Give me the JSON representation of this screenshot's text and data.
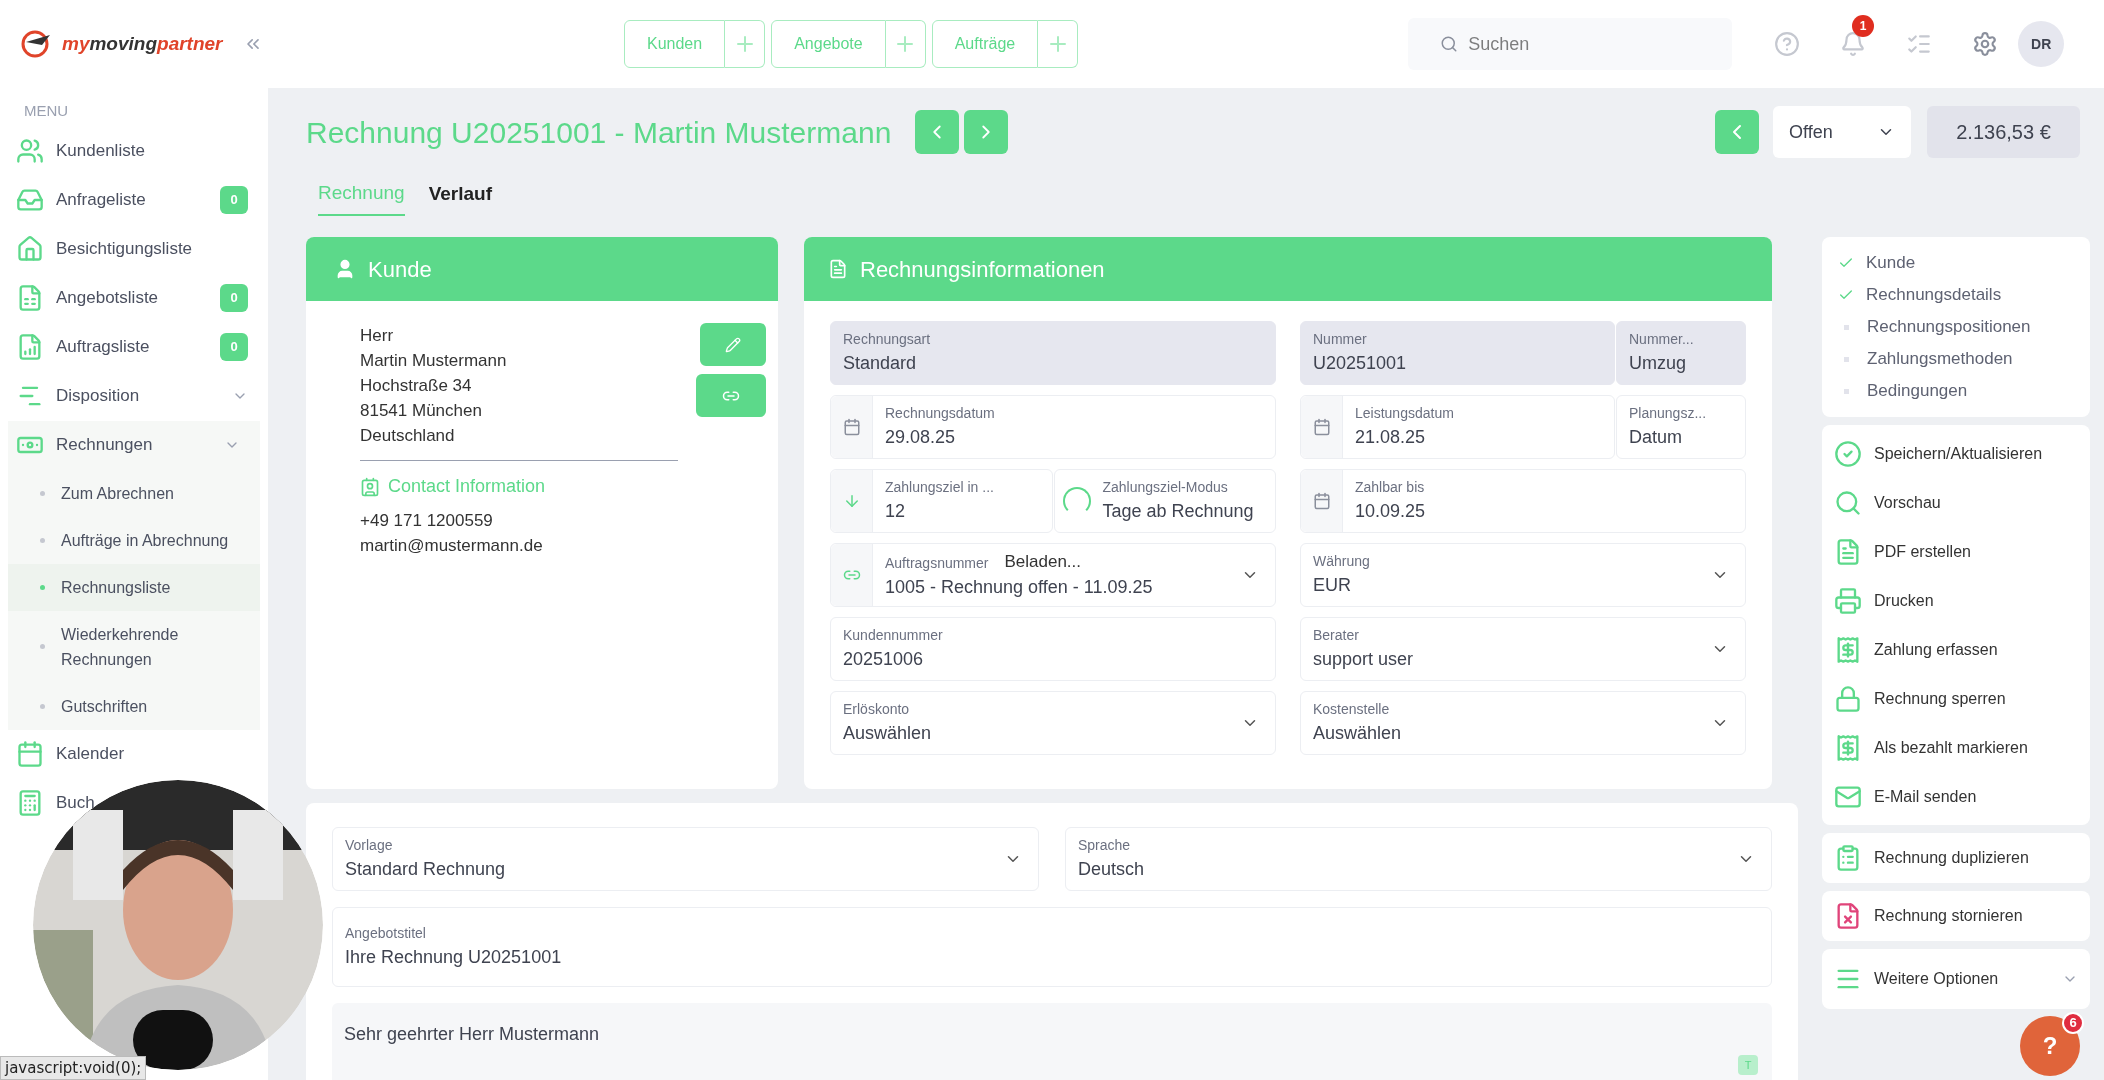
{
  "header": {
    "logo_parts": [
      {
        "text": "my",
        "kind": "accent"
      },
      {
        "text": "moving",
        "kind": "plain"
      },
      {
        "text": "partner",
        "kind": "accent"
      }
    ],
    "quick_create": [
      {
        "label": "Kunden"
      },
      {
        "label": "Angebote"
      },
      {
        "label": "Aufträge"
      }
    ],
    "search": {
      "placeholder": "Suchen"
    },
    "notification_count": "1",
    "avatar": "DR"
  },
  "sidebar": {
    "menu_label": "MENU",
    "items": [
      {
        "label": "Kundenliste",
        "kind": "link"
      },
      {
        "label": "Anfrageliste",
        "kind": "link",
        "badge": "0"
      },
      {
        "label": "Besichtigungsliste",
        "kind": "link"
      },
      {
        "label": "Angebotsliste",
        "kind": "link",
        "badge": "0"
      },
      {
        "label": "Auftragsliste",
        "kind": "link",
        "badge": "0"
      },
      {
        "label": "Disposition",
        "kind": "group"
      },
      {
        "label": "Rechnungen",
        "kind": "group",
        "expanded": true,
        "children": [
          {
            "label": "Zum Abrechnen",
            "selected": false
          },
          {
            "label": "Aufträge in Abrechnung",
            "selected": false
          },
          {
            "label": "Rechnungsliste",
            "selected": true
          },
          {
            "label": "Wiederkehrende Rechnungen",
            "selected": false
          },
          {
            "label": "Gutschriften",
            "selected": false
          }
        ]
      },
      {
        "label": "Kalender",
        "kind": "link"
      },
      {
        "label": "Buch",
        "kind": "link"
      }
    ]
  },
  "page": {
    "title": "Rechnung U20251001 - Martin Mustermann",
    "status": "Offen",
    "amount": "2.136,53 €",
    "tabs": [
      {
        "label": "Rechnung",
        "selected": true
      },
      {
        "label": "Verlauf",
        "selected": false
      }
    ]
  },
  "customer_card": {
    "title": "Kunde",
    "address": [
      "Herr",
      "Martin Mustermann",
      "Hochstraße 34",
      "81541 München",
      "Deutschland"
    ],
    "contact_title": "Contact Information",
    "phone": "+49 171 1200559",
    "email": "martin@mustermann.de"
  },
  "info_card": {
    "title": "Rechnungsinformationen",
    "left": [
      [
        {
          "label": "Rechnungsart",
          "value": "Standard",
          "kind": "readonly"
        }
      ],
      [
        {
          "label": "Rechnungsdatum",
          "value": "29.08.25",
          "kind": "date"
        }
      ],
      [
        {
          "label": "Zahlungsziel in ...",
          "value": "12",
          "kind": "term"
        },
        {
          "label": "Zahlungsziel-Modus",
          "value": "Tage ab Rechnung",
          "kind": "plain",
          "loading": true
        }
      ],
      [
        {
          "label": "Auftragsnummer",
          "value": "1005 - Rechnung offen - 11.09.25",
          "kind": "order",
          "loading_text": "Beladen..."
        }
      ],
      [
        {
          "label": "Kundennummer",
          "value": "20251006",
          "kind": "plain"
        }
      ],
      [
        {
          "label": "Erlöskonto",
          "value": "Auswählen",
          "kind": "select"
        }
      ]
    ],
    "right": [
      [
        {
          "label": "Nummer",
          "value": "U20251001",
          "kind": "readonly"
        },
        {
          "label": "Nummer...",
          "value": "Umzug",
          "kind": "readonly"
        }
      ],
      [
        {
          "label": "Leistungsdatum",
          "value": "21.08.25",
          "kind": "date"
        },
        {
          "label": "Planungsz...",
          "value": "Datum",
          "kind": "plain"
        }
      ],
      [
        {
          "label": "Zahlbar bis",
          "value": "10.09.25",
          "kind": "date"
        }
      ],
      [
        {
          "label": "Währung",
          "value": "EUR",
          "kind": "select"
        }
      ],
      [
        {
          "label": "Berater",
          "value": "support user",
          "kind": "select"
        }
      ],
      [
        {
          "label": "Kostenstelle",
          "value": "Auswählen",
          "kind": "select"
        }
      ]
    ]
  },
  "text_card": {
    "template": {
      "label": "Vorlage",
      "value": "Standard Rechnung"
    },
    "language": {
      "label": "Sprache",
      "value": "Deutsch"
    },
    "subject": {
      "label": "Angebotstitel",
      "value": "Ihre Rechnung U20251001"
    },
    "greeting": "Sehr geehrter Herr Mustermann",
    "editor_badge": "T"
  },
  "steps": [
    {
      "label": "Kunde",
      "done": true
    },
    {
      "label": "Rechnungsdetails",
      "done": true
    },
    {
      "label": "Rechnungspositionen",
      "done": false
    },
    {
      "label": "Zahlungsmethoden",
      "done": false
    },
    {
      "label": "Bedingungen",
      "done": false
    }
  ],
  "actions": [
    {
      "label": "Speichern/Aktualisieren"
    },
    {
      "label": "Vorschau"
    },
    {
      "label": "PDF erstellen"
    },
    {
      "label": "Drucken"
    },
    {
      "label": "Zahlung erfassen"
    },
    {
      "label": "Rechnung sperren"
    },
    {
      "label": "Als bezahlt markieren"
    },
    {
      "label": "E-Mail senden"
    }
  ],
  "extra_actions": [
    {
      "label": "Rechnung duplizieren",
      "kind": "plain"
    },
    {
      "label": "Rechnung stornieren",
      "kind": "danger"
    },
    {
      "label": "Weitere Optionen",
      "kind": "dropdown"
    }
  ],
  "status_bar": "javascript:void(0);",
  "help": {
    "label": "?",
    "badge": "6"
  }
}
